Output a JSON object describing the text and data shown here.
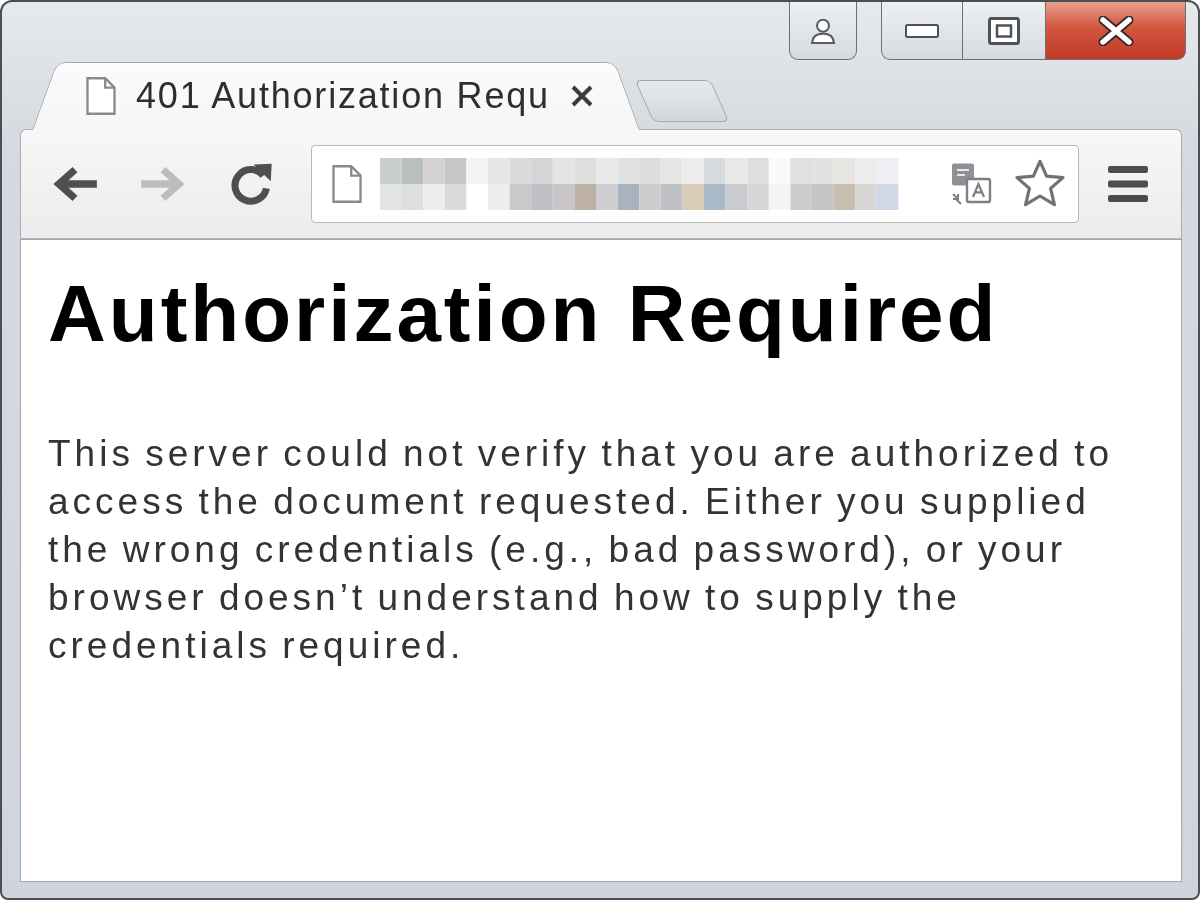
{
  "tabs": [
    {
      "title": "401 Authorization Requ",
      "selected": true
    }
  ],
  "toolbar": {
    "buttons": [
      {
        "kind": "back",
        "disabled": false
      },
      {
        "kind": "forward",
        "disabled": true
      },
      {
        "kind": "reload",
        "disabled": false
      }
    ]
  },
  "page": {
    "heading": "Authorization Required",
    "paragraph": "This server could not verify that you are authorized to access the document requested. Either you supplied the wrong credentials (e.g., bad password), or your browser doesn’t understand how to supply the credentials required."
  }
}
